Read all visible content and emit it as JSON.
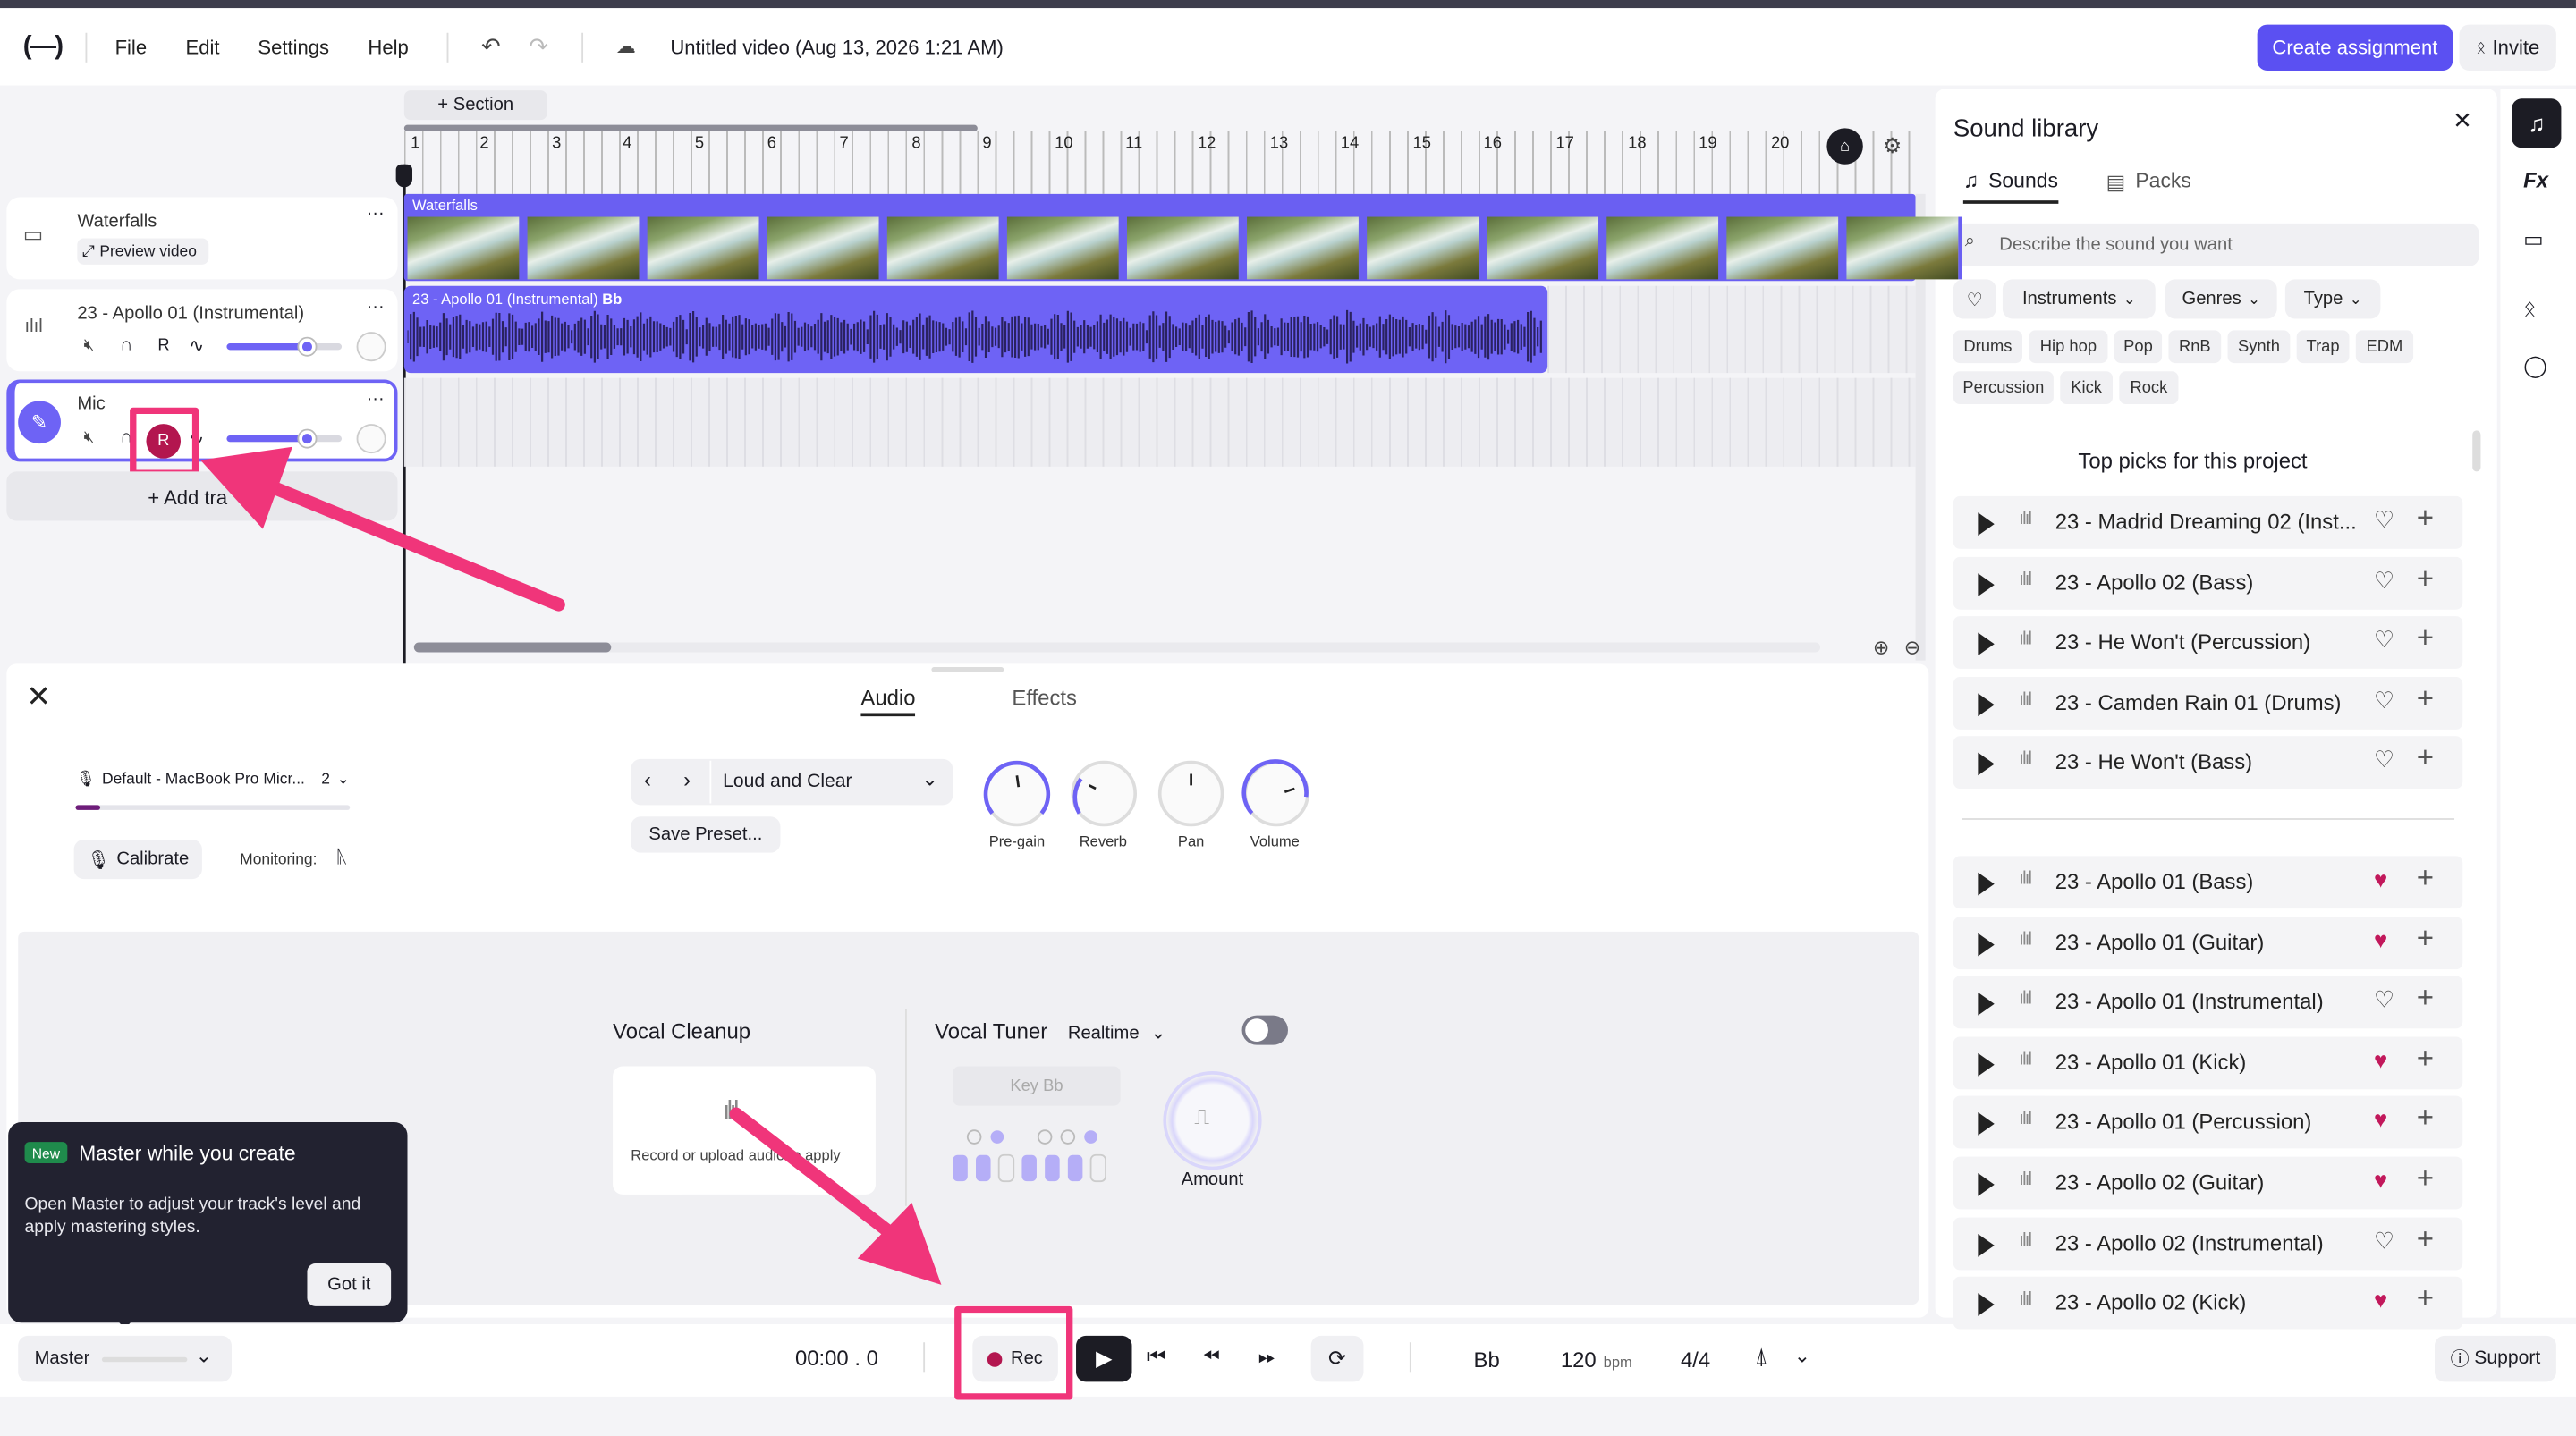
{
  "app": {
    "menu": [
      "File",
      "Edit",
      "Settings",
      "Help"
    ],
    "title": "Untitled video (Aug 13, 2026 1:21 AM)",
    "create_assignment": "Create assignment",
    "invite": "Invite"
  },
  "timeline": {
    "section_button": "+ Section",
    "ruler": [
      "1",
      "2",
      "3",
      "4",
      "5",
      "6",
      "7",
      "8",
      "9",
      "10",
      "11",
      "12",
      "13",
      "14",
      "15",
      "16",
      "17",
      "18",
      "19",
      "20"
    ],
    "video_clip_label": "Waterfalls",
    "audio_clip_label": "23 - Apollo 01 (Instrumental)",
    "audio_clip_key": "Bb"
  },
  "tracks": [
    {
      "name": "Waterfalls",
      "sub": "Preview video"
    },
    {
      "name": "23 - Apollo 01 (Instrumental)",
      "r": "R"
    },
    {
      "name": "Mic",
      "r": "R"
    }
  ],
  "add_track": "+ Add tra",
  "recorder": {
    "tabs": [
      "Audio",
      "Effects"
    ],
    "active_tab": "Audio",
    "device": "Default - MacBook Pro Micr...",
    "device_count": "2",
    "calibrate": "Calibrate",
    "monitoring": "Monitoring:",
    "preset": "Loud and Clear",
    "save_preset": "Save Preset...",
    "knobs": [
      "Pre-gain",
      "Reverb",
      "Pan",
      "Volume"
    ],
    "vocal_cleanup": "Vocal Cleanup",
    "cleanup_hint": "Record or upload audio to apply",
    "vocal_tuner": "Vocal Tuner",
    "tuner_mode": "Realtime",
    "key": "Key Bb",
    "amount": "Amount"
  },
  "tooltip": {
    "badge": "New",
    "title": "Master while you create",
    "body": "Open Master to adjust your track's level and apply mastering styles.",
    "button": "Got it"
  },
  "transport": {
    "master": "Master",
    "time": "00:00 . 0",
    "rec": "Rec",
    "key": "Bb",
    "bpm": "120",
    "bpm_unit": "bpm",
    "signature": "4/4",
    "support": "Support"
  },
  "library": {
    "title": "Sound library",
    "tabs": [
      "Sounds",
      "Packs"
    ],
    "search_placeholder": "Describe the sound you want",
    "filters": [
      "Instruments",
      "Genres",
      "Type"
    ],
    "tags": [
      "Drums",
      "Hip hop",
      "Pop",
      "RnB",
      "Synth",
      "Trap",
      "EDM",
      "Percussion",
      "Kick",
      "Rock"
    ],
    "top_picks_title": "Top picks for this project",
    "top_picks": [
      {
        "name": "23 - Madrid Dreaming 02 (Inst...",
        "liked": false
      },
      {
        "name": "23 - Apollo 02 (Bass)",
        "liked": false
      },
      {
        "name": "23 - He Won't (Percussion)",
        "liked": false
      },
      {
        "name": "23 - Camden Rain 01 (Drums)",
        "liked": false
      },
      {
        "name": "23 - He Won't (Bass)",
        "liked": false
      }
    ],
    "more": [
      {
        "name": "23 - Apollo 01 (Bass)",
        "liked": true
      },
      {
        "name": "23 - Apollo 01 (Guitar)",
        "liked": true
      },
      {
        "name": "23 - Apollo 01 (Instrumental)",
        "liked": false
      },
      {
        "name": "23 - Apollo 01 (Kick)",
        "liked": true
      },
      {
        "name": "23 - Apollo 01 (Percussion)",
        "liked": true
      },
      {
        "name": "23 - Apollo 02 (Guitar)",
        "liked": true
      },
      {
        "name": "23 - Apollo 02 (Instrumental)",
        "liked": false
      },
      {
        "name": "23 - Apollo 02 (Kick)",
        "liked": true
      }
    ]
  },
  "colors": {
    "accent": "#5b50f2",
    "annotation": "#f0357a",
    "heart": "#c2185b"
  }
}
